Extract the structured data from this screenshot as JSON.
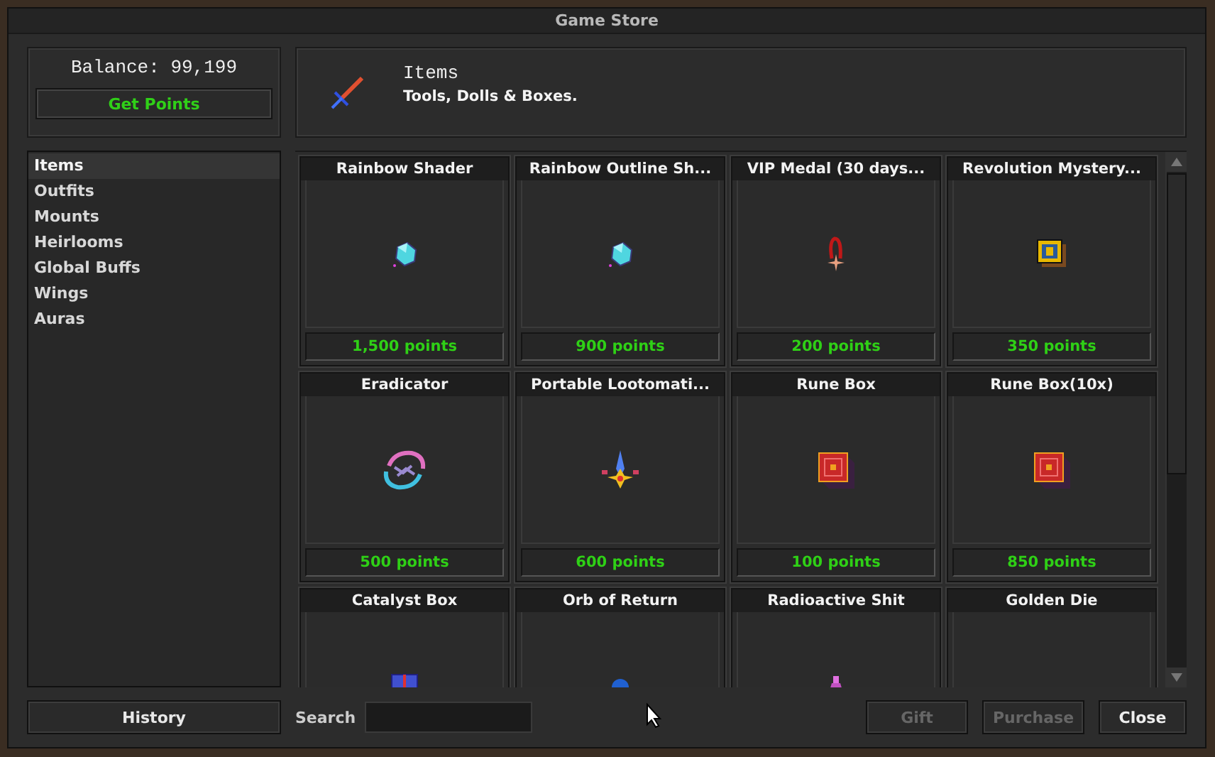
{
  "window": {
    "title": "Game Store"
  },
  "balance": {
    "label": "Balance: 99,199"
  },
  "get_points_button": "Get Points",
  "category_header": {
    "title": "Items",
    "description": "Tools, Dolls & Boxes."
  },
  "categories": [
    {
      "label": "Items",
      "selected": true
    },
    {
      "label": "Outfits",
      "selected": false
    },
    {
      "label": "Mounts",
      "selected": false
    },
    {
      "label": "Heirlooms",
      "selected": false
    },
    {
      "label": "Global Buffs",
      "selected": false
    },
    {
      "label": "Wings",
      "selected": false
    },
    {
      "label": "Auras",
      "selected": false
    }
  ],
  "products": [
    {
      "name": "Rainbow Shader",
      "price": "1,500 points",
      "kind": "gem"
    },
    {
      "name": "Rainbow Outline Sh...",
      "price": "900 points",
      "kind": "gem"
    },
    {
      "name": "VIP Medal (30 days...",
      "price": "200 points",
      "kind": "medal"
    },
    {
      "name": "Revolution Mystery...",
      "price": "350 points",
      "kind": "chest"
    },
    {
      "name": "Eradicator",
      "price": "500 points",
      "kind": "ring"
    },
    {
      "name": "Portable Lootomati...",
      "price": "600 points",
      "kind": "star"
    },
    {
      "name": "Rune Box",
      "price": "100 points",
      "kind": "cube"
    },
    {
      "name": "Rune Box(10x)",
      "price": "850 points",
      "kind": "cube"
    },
    {
      "name": "Catalyst Box",
      "kind": "catalyst"
    },
    {
      "name": "Orb of Return",
      "kind": "orb"
    },
    {
      "name": "Radioactive Shit",
      "kind": "flask"
    },
    {
      "name": "Golden Die"
    }
  ],
  "history_button": "History",
  "search": {
    "label": "Search"
  },
  "buttons": [
    {
      "label": "Gift",
      "disabled": true
    },
    {
      "label": "Purchase",
      "disabled": true
    },
    {
      "label": "Close",
      "disabled": false
    }
  ]
}
